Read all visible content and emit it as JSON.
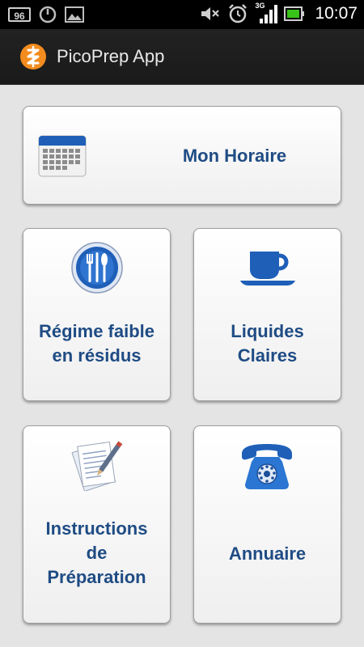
{
  "status_bar": {
    "battery_level": "96",
    "time": "10:07",
    "network": "3G",
    "icons": [
      "battery-icon",
      "settings-circle-icon",
      "image-icon",
      "mute-icon",
      "alarm-icon",
      "signal-icon",
      "battery-full-icon"
    ]
  },
  "app_bar": {
    "title": "PicoPrep App",
    "logo_color": "#f28c1e"
  },
  "menu": {
    "mon_horaire": {
      "label": "Mon Horaire",
      "icon": "calendar-icon"
    },
    "regime": {
      "line1": "Régime faible",
      "line2": "en résidus",
      "icon": "plate-utensils-icon"
    },
    "liquides": {
      "line1": "Liquides",
      "line2": "Claires",
      "icon": "cup-icon"
    },
    "instructions": {
      "line1": "Instructions",
      "line2": "de",
      "line3": "Préparation",
      "icon": "document-pen-icon"
    },
    "annuaire": {
      "label": "Annuaire",
      "icon": "telephone-icon"
    }
  },
  "colors": {
    "label": "#1f4c84",
    "accent_blue": "#1f5fb8",
    "background": "#e4e4e4"
  }
}
